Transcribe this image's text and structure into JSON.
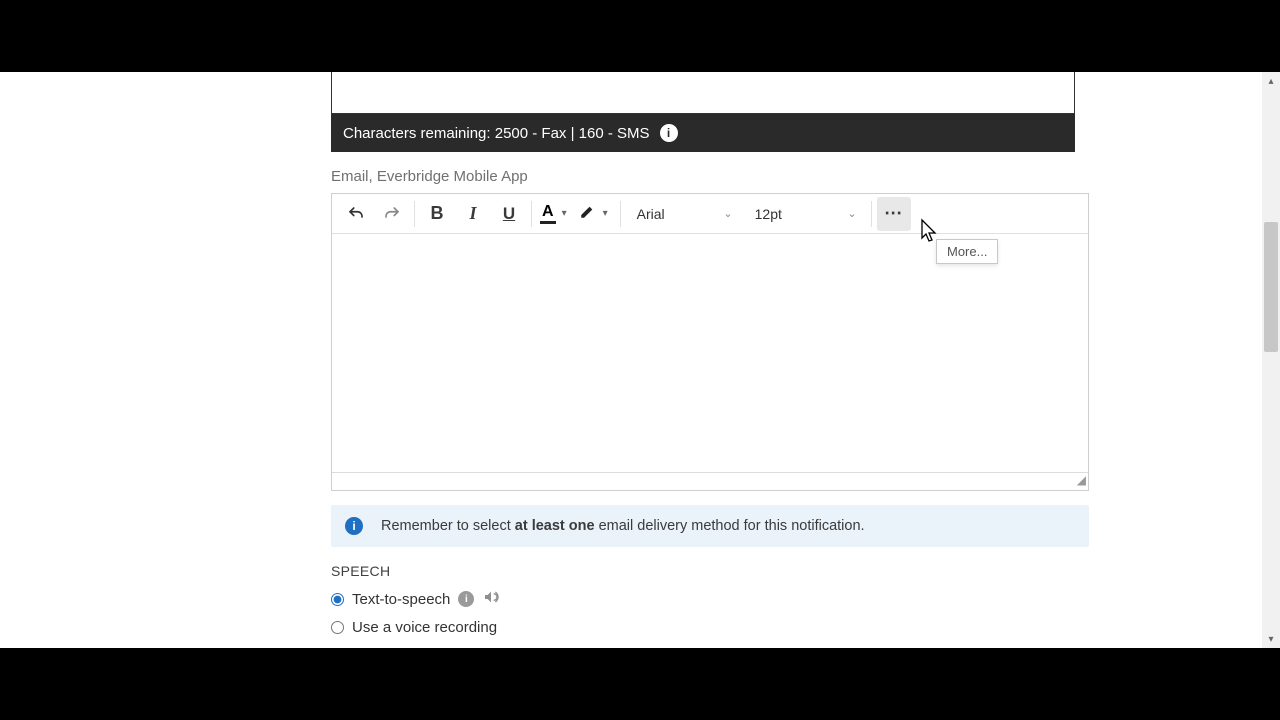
{
  "charBar": {
    "text": "Characters remaining: 2500 - Fax   |   160 - SMS"
  },
  "editorLabel": "Email, Everbridge Mobile App",
  "toolbar": {
    "fontFamily": "Arial",
    "fontSize": "12pt",
    "moreTooltip": "More..."
  },
  "alert": {
    "pre": "Remember to select ",
    "bold": "at least one",
    "post": " email delivery method for this notification."
  },
  "speech": {
    "heading": "SPEECH",
    "options": {
      "tts": "Text-to-speech",
      "voice": "Use a voice recording"
    },
    "selected": "tts"
  }
}
